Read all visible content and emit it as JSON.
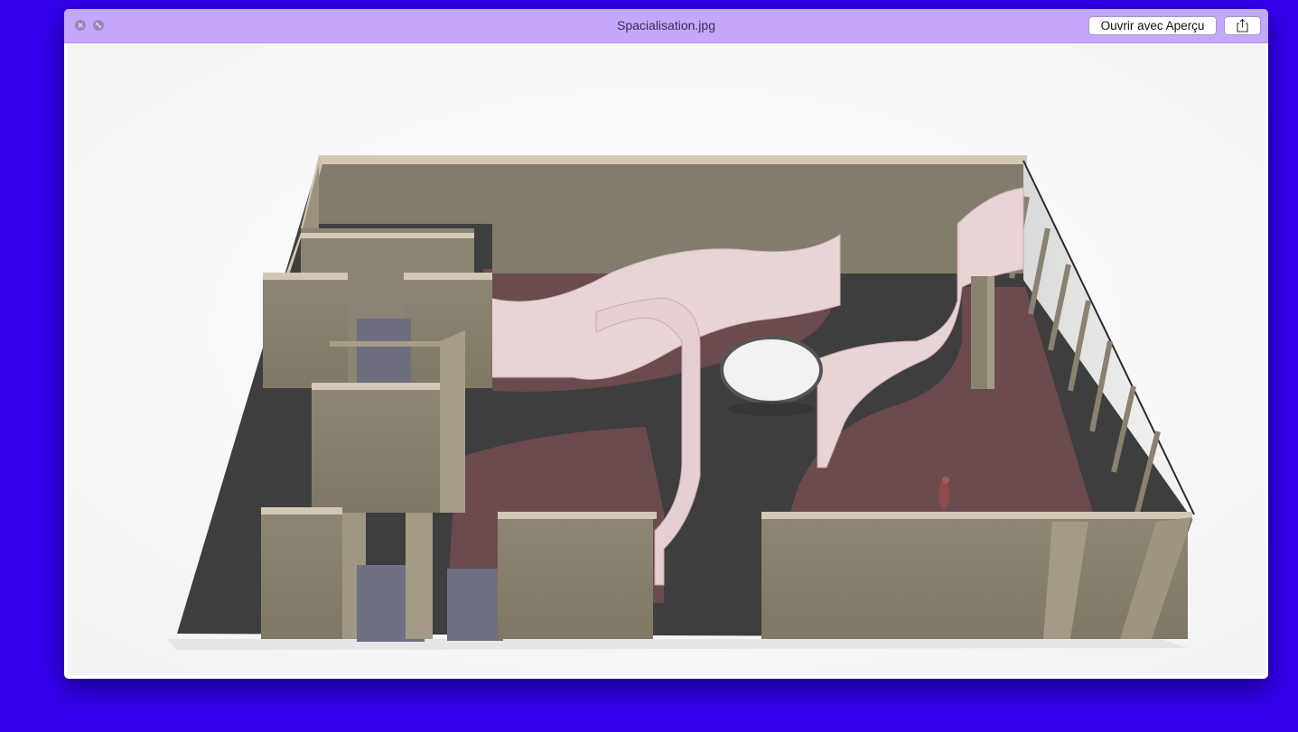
{
  "window": {
    "title": "Spacialisation.jpg"
  },
  "toolbar": {
    "open_with_label": "Ouvrir avec Aperçu",
    "share_icon": "share-icon"
  },
  "controls": {
    "close_icon": "close-icon",
    "fullscreen_icon": "fullscreen-icon"
  },
  "colors": {
    "desktop": "#3300ee",
    "titlebar": "#c4a6fb",
    "wall": "#8a8271",
    "floor_dark": "#3e3e3e",
    "floor_carpet": "#6d4b4f",
    "partition": "#e6cfd2"
  }
}
